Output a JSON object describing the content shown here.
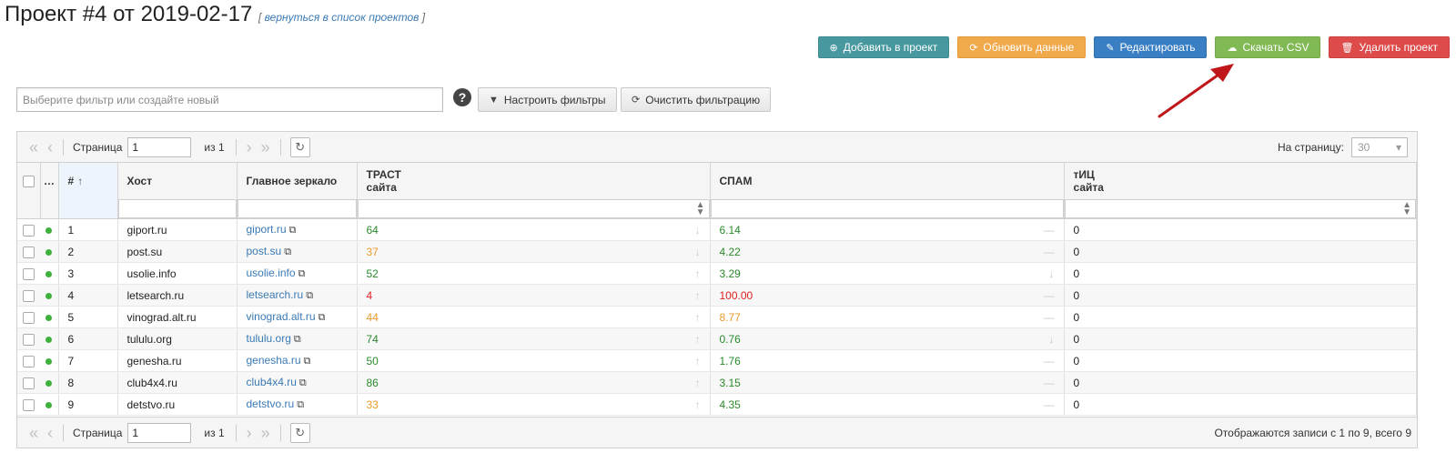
{
  "page": {
    "title": "Проект #4 от 2019-02-17",
    "back_link": "вернуться в список проектов"
  },
  "actions": {
    "add": "Добавить в проект",
    "refresh": "Обновить данные",
    "edit": "Редактировать",
    "csv": "Скачать CSV",
    "delete": "Удалить проект"
  },
  "filters": {
    "placeholder": "Выберите фильтр или создайте новый",
    "configure": "Настроить фильтры",
    "clear": "Очистить фильтрацию"
  },
  "pager": {
    "page_label": "Страница",
    "page_value": "1",
    "of_label": "из 1",
    "per_page_label": "На страницу:",
    "per_page_value": "30",
    "records_info": "Отображаются записи с 1 по 9, всего 9"
  },
  "columns": {
    "num": "#",
    "host": "Хост",
    "mirror": "Главное зеркало",
    "trust": "ТРАСТ сайта",
    "spam": "СПАМ",
    "tic": "тИЦ сайта"
  },
  "colors": {
    "good": "#2a8a2a",
    "warn": "#ea9a2a",
    "bad": "#e02020",
    "status_ok": "#3eb03e"
  },
  "rows": [
    {
      "num": "1",
      "host": "giport.ru",
      "mirror": "giport.ru",
      "trust": "64",
      "trust_color": "green",
      "trust_trend": "down-icon",
      "spam": "6.14",
      "spam_color": "green",
      "spam_trend": "flat-icon",
      "tic": "0"
    },
    {
      "num": "2",
      "host": "post.su",
      "mirror": "post.su",
      "trust": "37",
      "trust_color": "orange",
      "trust_trend": "down-icon",
      "spam": "4.22",
      "spam_color": "green",
      "spam_trend": "flat-icon",
      "tic": "0"
    },
    {
      "num": "3",
      "host": "usolie.info",
      "mirror": "usolie.info",
      "trust": "52",
      "trust_color": "green",
      "trust_trend": "up-icon",
      "spam": "3.29",
      "spam_color": "green",
      "spam_trend": "down-icon",
      "tic": "0"
    },
    {
      "num": "4",
      "host": "letsearch.ru",
      "mirror": "letsearch.ru",
      "trust": "4",
      "trust_color": "red",
      "trust_trend": "up-icon",
      "spam": "100.00",
      "spam_color": "red",
      "spam_trend": "flat-icon",
      "tic": "0"
    },
    {
      "num": "5",
      "host": "vinograd.alt.ru",
      "mirror": "vinograd.alt.ru",
      "trust": "44",
      "trust_color": "orange",
      "trust_trend": "up-icon",
      "spam": "8.77",
      "spam_color": "orange",
      "spam_trend": "flat-icon",
      "tic": "0"
    },
    {
      "num": "6",
      "host": "tululu.org",
      "mirror": "tululu.org",
      "trust": "74",
      "trust_color": "green",
      "trust_trend": "up-icon",
      "spam": "0.76",
      "spam_color": "green",
      "spam_trend": "down-icon",
      "tic": "0"
    },
    {
      "num": "7",
      "host": "genesha.ru",
      "mirror": "genesha.ru",
      "trust": "50",
      "trust_color": "green",
      "trust_trend": "up-icon",
      "spam": "1.76",
      "spam_color": "green",
      "spam_trend": "flat-icon",
      "tic": "0"
    },
    {
      "num": "8",
      "host": "club4x4.ru",
      "mirror": "club4x4.ru",
      "trust": "86",
      "trust_color": "green",
      "trust_trend": "up-icon",
      "spam": "3.15",
      "spam_color": "green",
      "spam_trend": "flat-icon",
      "tic": "0"
    },
    {
      "num": "9",
      "host": "detstvo.ru",
      "mirror": "detstvo.ru",
      "trust": "33",
      "trust_color": "orange",
      "trust_trend": "up-icon",
      "spam": "4.35",
      "spam_color": "green",
      "spam_trend": "flat-icon",
      "tic": "0"
    }
  ]
}
